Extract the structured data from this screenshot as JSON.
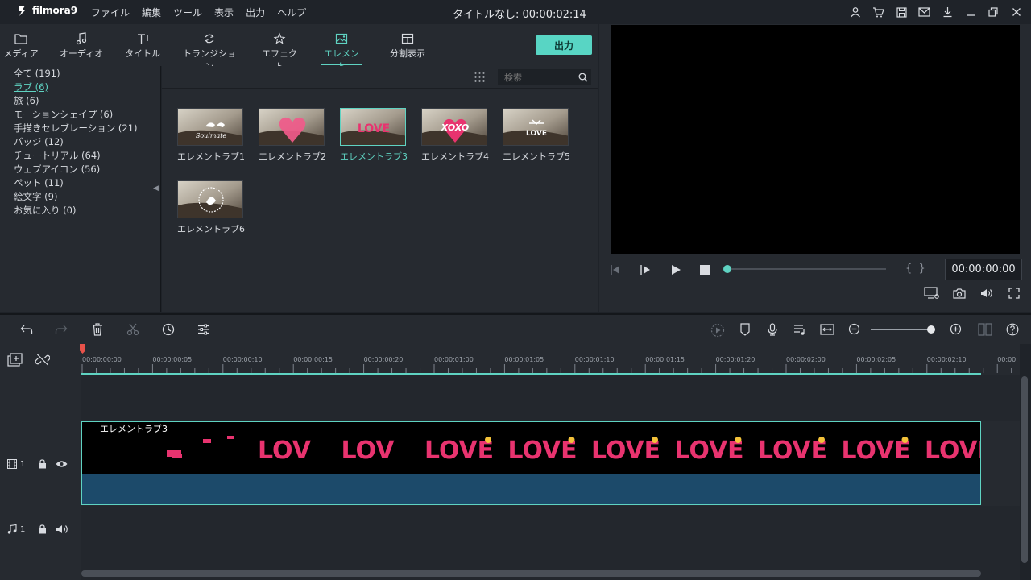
{
  "app": {
    "name": "filmora9",
    "doc_title": "タイトルなし:  00:00:02:14"
  },
  "menu": [
    "ファイル",
    "編集",
    "ツール",
    "表示",
    "出力",
    "ヘルプ"
  ],
  "window_icons": [
    "user-icon",
    "cart-icon",
    "save-icon",
    "mail-icon",
    "download-icon",
    "minimize-icon",
    "restore-icon",
    "close-icon"
  ],
  "tabs": [
    {
      "label": "メディア",
      "icon": "folder-icon"
    },
    {
      "label": "オーディオ",
      "icon": "music-note-icon"
    },
    {
      "label": "タイトル",
      "icon": "title-text-icon"
    },
    {
      "label": "トランジション",
      "icon": "transition-icon"
    },
    {
      "label": "エフェクト",
      "icon": "effects-icon"
    },
    {
      "label": "エレメント",
      "icon": "image-icon",
      "active": true
    },
    {
      "label": "分割表示",
      "icon": "split-screen-icon"
    }
  ],
  "export_label": "出力",
  "categories": [
    {
      "label": "全て (191)"
    },
    {
      "label": "ラブ (6)",
      "active": true
    },
    {
      "label": "旅 (6)"
    },
    {
      "label": "モーションシェイプ (6)"
    },
    {
      "label": "手描きセレブレーション (21)"
    },
    {
      "label": "バッジ (12)"
    },
    {
      "label": "チュートリアル (64)"
    },
    {
      "label": "ウェブアイコン (56)"
    },
    {
      "label": "ペット (11)"
    },
    {
      "label": "絵文字 (9)"
    },
    {
      "label": "お気に入り (0)"
    }
  ],
  "search": {
    "placeholder": "検索"
  },
  "elements": [
    {
      "label": "エレメントラブ1"
    },
    {
      "label": "エレメントラブ2"
    },
    {
      "label": "エレメントラブ3",
      "active": true
    },
    {
      "label": "エレメントラブ4"
    },
    {
      "label": "エレメントラブ5"
    },
    {
      "label": "エレメントラブ6"
    }
  ],
  "thumb_text": {
    "t1": "Soulmate",
    "t3": "LOVE",
    "t4": "XOXO",
    "t5": "LOVE"
  },
  "preview": {
    "timecode": "00:00:00:00",
    "progress": 0
  },
  "ruler_ticks": [
    "00:00:00:00",
    "00:00:00:05",
    "00:00:00:10",
    "00:00:00:15",
    "00:00:00:20",
    "00:00:01:00",
    "00:00:01:05",
    "00:00:01:10",
    "00:00:01:15",
    "00:00:01:20",
    "00:00:02:00",
    "00:00:02:05",
    "00:00:02:10",
    "00:00:"
  ],
  "tracks": {
    "video_label": "1",
    "audio_label": "1"
  },
  "clip": {
    "label": "エレメントラブ3",
    "frames": [
      "",
      "",
      "LOV",
      "LOV",
      "LOVE",
      "LOVE",
      "LOVE",
      "LOVE",
      "LOVE",
      "LOVE",
      "LOVE",
      "LOV"
    ]
  },
  "colors": {
    "accent": "#5fd3c2",
    "playhead": "#e8524a",
    "love_pink": "#e8336f",
    "love_yellow": "#f3c23a"
  }
}
